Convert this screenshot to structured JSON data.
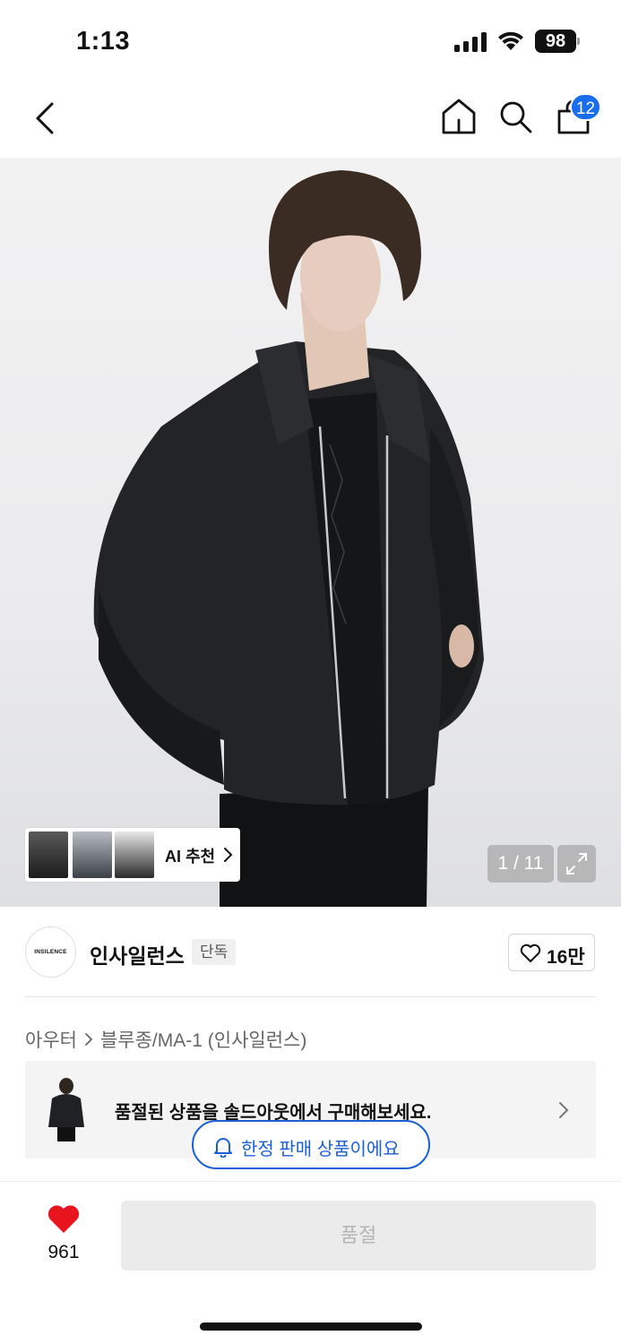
{
  "status_bar": {
    "time": "1:13",
    "battery": "98"
  },
  "header": {
    "back_icon": "chevron-left-icon",
    "home_icon": "home-icon",
    "search_icon": "search-icon",
    "cart_icon": "shopping-bag-icon",
    "cart_count": "12"
  },
  "hero": {
    "ai_label": "AI 추천",
    "page_counter": "1 / 11",
    "expand_icon": "expand-icon"
  },
  "brand": {
    "logo_text": "INSILENCE",
    "name": "인사일런스",
    "tag": "단독",
    "like_count": "16만"
  },
  "breadcrumb": {
    "items": [
      "아우터",
      "블루종/MA-1 (인사일런스)"
    ]
  },
  "soldout_banner": {
    "text": "품절된 상품을 솔드아웃에서 구매해보세요."
  },
  "limited_pill": {
    "label": "한정 판매 상품이에요",
    "icon": "bell-icon"
  },
  "bottom_bar": {
    "wish_count": "961",
    "action_label": "품절"
  },
  "colors": {
    "accent_blue": "#1a6cf0",
    "heart_red": "#e8141e",
    "disabled_bg": "#ebebeb"
  }
}
